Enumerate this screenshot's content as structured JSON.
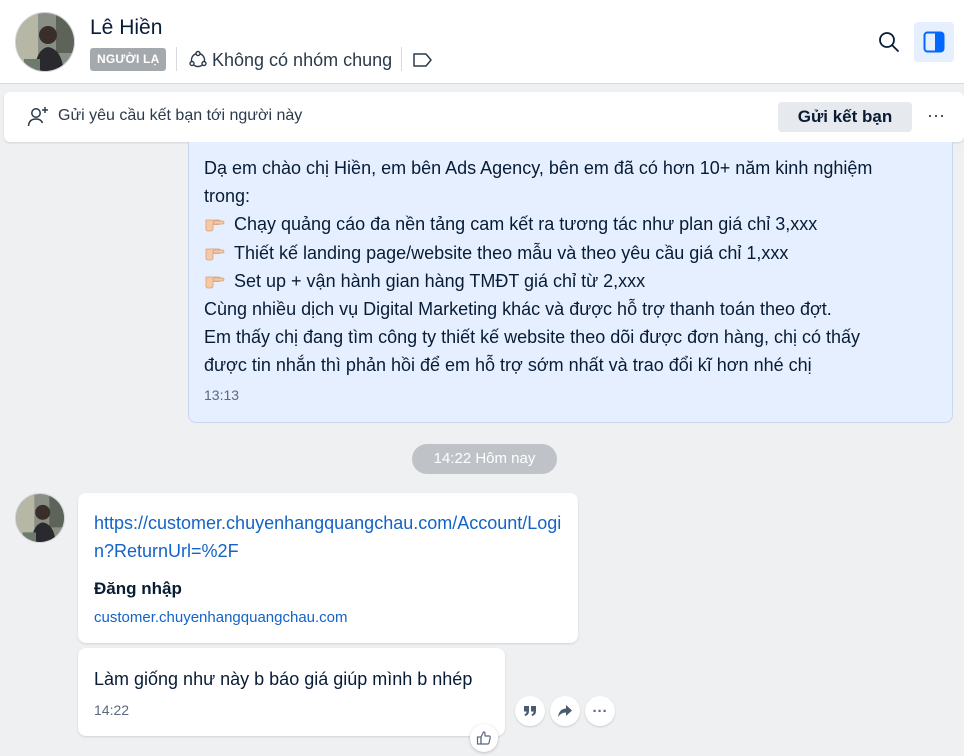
{
  "header": {
    "contact_name": "Lê Hiền",
    "stranger_badge": "NGƯỜI LẠ",
    "group_info": "Không có nhóm chung"
  },
  "friend_bar": {
    "text": "Gửi yêu cầu kết bạn tới người này",
    "button_label": "Gửi kết bạn",
    "more_label": "···"
  },
  "sent_message": {
    "lines": [
      "Dạ em chào chị Hiền, em bên Ads Agency, bên em đã có hơn 10+ năm kinh nghiệm",
      "trong:",
      "Chạy quảng cáo đa nền tảng cam kết ra tương tác như plan giá chỉ 3,xxx",
      "Thiết kế landing page/website theo mẫu và theo yêu cầu giá chỉ 1,xxx",
      "Set up + vận hành gian hàng TMĐT giá chỉ từ 2,xxx",
      "Cùng nhiều dịch vụ Digital Marketing khác và được hỗ trợ thanh toán theo đợt.",
      "Em thấy chị đang tìm công ty thiết kế website theo dõi được đơn hàng, chị có thấy",
      "được tin nhắn thì phản hồi để em hỗ trợ sớm nhất và trao đổi kĩ hơn nhé chị"
    ],
    "time": "13:13"
  },
  "date_divider": "14:22 Hôm nay",
  "link_message": {
    "url": "https://customer.chuyenhangquangchau.com/Account/Login?ReturnUrl=%2F",
    "title": "Đăng nhập",
    "domain": "customer.chuyenhangquangchau.com"
  },
  "text_message": {
    "text": "Làm giống như này b báo giá giúp mình b nhép",
    "time": "14:22"
  },
  "actions": {
    "more_label": "···"
  },
  "colors": {
    "accent": "#1463c7",
    "sent_bubble": "#e5efff",
    "background": "#eef0f1",
    "stranger_badge": "#a4a9ae"
  },
  "icons": [
    "search-icon",
    "sidebar-toggle-icon",
    "group-icon",
    "tag-icon",
    "add-friend-icon",
    "point-right-icon",
    "quote-icon",
    "share-icon",
    "like-icon"
  ]
}
